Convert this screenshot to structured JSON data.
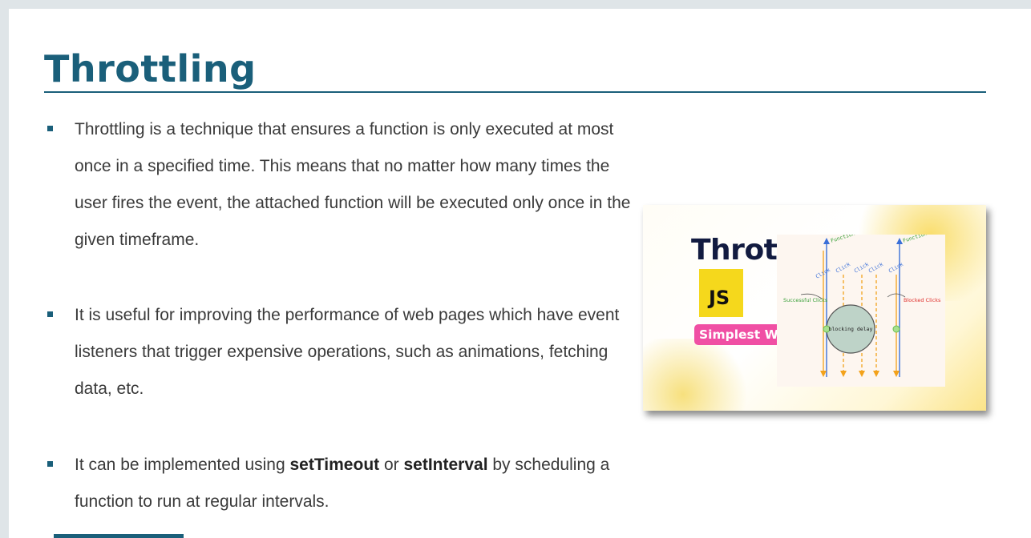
{
  "slide": {
    "title": "Throttling",
    "bullets": [
      {
        "text": "Throttling is a technique that ensures a function is only executed at most once in a specified time. This means that no matter how many times the user fires the event, the attached function will be executed only once in the given timeframe."
      },
      {
        "text": "It is useful for improving the performance of web pages which have event listeners that trigger expensive operations, such as animations, fetching data, etc."
      },
      {
        "pre": "It can be implemented using ",
        "bold1": "setTimeout",
        "mid": " or ",
        "bold2": "setInterval",
        "post": " by scheduling a function to run at regular intervals."
      }
    ]
  },
  "thumbnail": {
    "title": "Throttle",
    "badge": "JS",
    "tag": "Simplest Way",
    "diagram": {
      "function_execution": "Function execution",
      "clicks": [
        "Click",
        "Click",
        "Click",
        "Click",
        "Click"
      ],
      "successful_clicks": "Successful Clicks",
      "blocked_clicks": "Blocked Clicks",
      "blocking_delay": "blocking delay"
    }
  },
  "colors": {
    "accent": "#1a5f7a",
    "js_yellow": "#f5d81c",
    "tag_pink": "#f04fa4",
    "arrow_blue": "#3a6fd8",
    "arrow_orange": "#f3a21b"
  }
}
